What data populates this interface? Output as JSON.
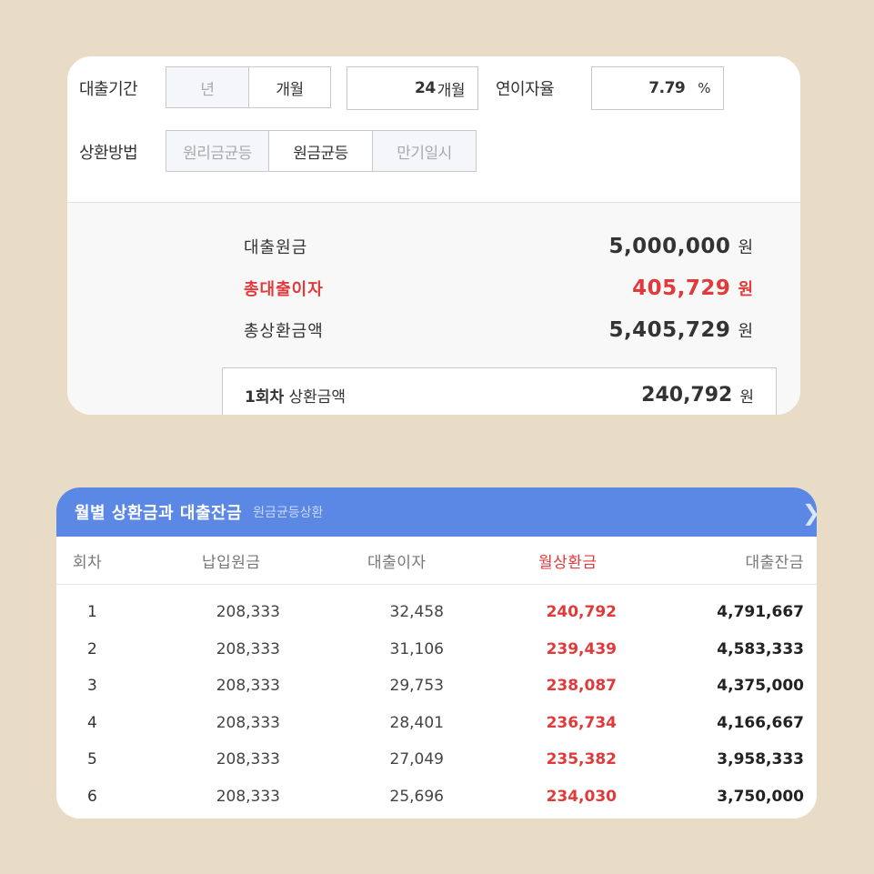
{
  "calculator": {
    "period_label": "대출기간",
    "period_unit_year": "년",
    "period_unit_month": "개월",
    "period_value": "24",
    "period_value_unit": "개월",
    "rate_label": "연이자율",
    "rate_value": "7.79",
    "rate_unit": "%",
    "method_label": "상환방법",
    "methods": [
      "원리금균등",
      "원금균등",
      "만기일시"
    ],
    "selected_method": "원금균등"
  },
  "results": {
    "principal_label": "대출원금",
    "principal_value": "5,000,000",
    "total_interest_label": "총대출이자",
    "total_interest_value": "405,729",
    "total_repay_label": "총상환금액",
    "total_repay_value": "5,405,729",
    "unit": "원",
    "first_payment_label_bold": "1회차",
    "first_payment_label": "상환금액",
    "first_payment_value": "240,792"
  },
  "schedule": {
    "title": "월별 상환금과 대출잔금",
    "subtitle": "원금균등상환",
    "chevron": "chevron-right-icon",
    "columns": [
      "회차",
      "납입원금",
      "대출이자",
      "월상환금",
      "대출잔금"
    ],
    "rows": [
      [
        "1",
        "208,333",
        "32,458",
        "240,792",
        "4,791,667"
      ],
      [
        "2",
        "208,333",
        "31,106",
        "239,439",
        "4,583,333"
      ],
      [
        "3",
        "208,333",
        "29,753",
        "238,087",
        "4,375,000"
      ],
      [
        "4",
        "208,333",
        "28,401",
        "236,734",
        "4,166,667"
      ],
      [
        "5",
        "208,333",
        "27,049",
        "235,382",
        "3,958,333"
      ],
      [
        "6",
        "208,333",
        "25,696",
        "234,030",
        "3,750,000"
      ]
    ]
  },
  "colors": {
    "background": "#e8dcc6",
    "header_blue": "#5b87e5",
    "accent_red": "#e03a3a"
  }
}
